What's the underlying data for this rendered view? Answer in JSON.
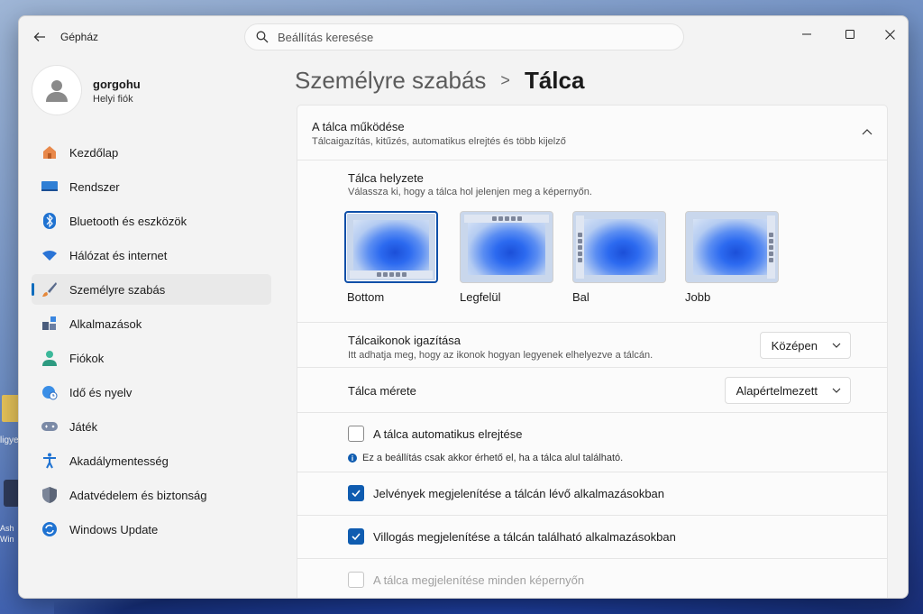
{
  "desktop": {
    "label1": "ligye",
    "label2": "Ash Win"
  },
  "window": {
    "title": "Gépház",
    "search_placeholder": "Beállítás keresése"
  },
  "profile": {
    "name": "gorgohu",
    "account_type": "Helyi fiók"
  },
  "sidebar": {
    "items": [
      {
        "label": "Kezdőlap",
        "icon": "home-icon"
      },
      {
        "label": "Rendszer",
        "icon": "system-icon"
      },
      {
        "label": "Bluetooth és eszközök",
        "icon": "bluetooth-icon"
      },
      {
        "label": "Hálózat és internet",
        "icon": "wifi-icon"
      },
      {
        "label": "Személyre szabás",
        "icon": "brush-icon",
        "active": true
      },
      {
        "label": "Alkalmazások",
        "icon": "apps-icon"
      },
      {
        "label": "Fiókok",
        "icon": "account-icon"
      },
      {
        "label": "Idő és nyelv",
        "icon": "globe-clock-icon"
      },
      {
        "label": "Játék",
        "icon": "gamepad-icon"
      },
      {
        "label": "Akadálymentesség",
        "icon": "accessibility-icon"
      },
      {
        "label": "Adatvédelem és biztonság",
        "icon": "shield-icon"
      },
      {
        "label": "Windows Update",
        "icon": "update-icon"
      }
    ]
  },
  "breadcrumb": {
    "parent": "Személyre szabás",
    "separator": ">",
    "current": "Tálca"
  },
  "section": {
    "title": "A tálca működése",
    "subtitle": "Tálcaigazítás, kitűzés, automatikus elrejtés és több kijelző"
  },
  "position": {
    "title": "Tálca helyzete",
    "subtitle": "Válassza ki, hogy a tálca hol jelenjen meg a képernyőn.",
    "options": [
      "Bottom",
      "Legfelül",
      "Bal",
      "Jobb"
    ],
    "selected": "Bottom"
  },
  "alignment": {
    "title": "Tálcaikonok igazítása",
    "subtitle": "Itt adhatja meg, hogy az ikonok hogyan legyenek elhelyezve a tálcán.",
    "value": "Középen"
  },
  "size": {
    "title": "Tálca mérete",
    "value": "Alapértelmezett"
  },
  "autohide": {
    "label": "A tálca automatikus elrejtése",
    "checked": false,
    "info": "Ez a beállítás csak akkor érhető el, ha a tálca alul található."
  },
  "badges": {
    "label": "Jelvények megjelenítése a tálcán lévő alkalmazásokban",
    "checked": true
  },
  "flashing": {
    "label": "Villogás megjelenítése a tálcán található alkalmazásokban",
    "checked": true
  },
  "all_displays": {
    "label": "A tálca megjelenítése minden képernyőn",
    "checked": false,
    "disabled": true
  },
  "colors": {
    "accent": "#0f5cb0",
    "window_bg": "#f3f3f3",
    "card_bg": "#fbfbfb"
  }
}
